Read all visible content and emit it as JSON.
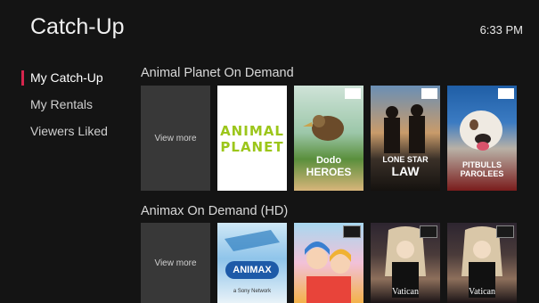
{
  "header": {
    "title": "Catch-Up",
    "time": "6:33 PM"
  },
  "sidebar": {
    "items": [
      {
        "label": "My Catch-Up",
        "active": true
      },
      {
        "label": "My Rentals",
        "active": false
      },
      {
        "label": "Viewers Liked",
        "active": false
      }
    ]
  },
  "rows": [
    {
      "title": "Animal Planet On Demand",
      "tiles": [
        {
          "kind": "view-more",
          "label": "View more"
        },
        {
          "kind": "poster",
          "name": "Animal Planet",
          "art": "animal-planet-logo"
        },
        {
          "kind": "poster",
          "name": "Dodo Heroes",
          "art": "dodo-heroes"
        },
        {
          "kind": "poster",
          "name": "Lone Star Law",
          "art": "lone-star-law"
        },
        {
          "kind": "poster",
          "name": "Pitbulls & Parolees",
          "art": "pitbulls-parolees"
        }
      ]
    },
    {
      "title": "Animax On Demand (HD)",
      "tiles": [
        {
          "kind": "view-more",
          "label": "View more"
        },
        {
          "kind": "poster",
          "name": "Animax",
          "art": "animax-logo"
        },
        {
          "kind": "poster",
          "name": "anime-poster",
          "art": "anime-poster"
        },
        {
          "kind": "poster",
          "name": "Vatican",
          "art": "vatican"
        },
        {
          "kind": "poster",
          "name": "Vatican",
          "art": "vatican"
        }
      ]
    }
  ],
  "poster_text": {
    "animal_planet_top": "ANIMAL",
    "animal_planet_bottom": "PLANET",
    "dodo_line1": "Dodo",
    "dodo_line2": "HEROES",
    "lonestar_line1": "LONE STAR",
    "lonestar_line2": "LAW",
    "pitbull_line1": "PITBULLS",
    "pitbull_line2": "PAROLEES",
    "animax_logo": "ANIMAX",
    "animax_sub": "a Sony Network",
    "vatican": "Vatican"
  },
  "colors": {
    "background": "#141414",
    "accent": "#d6254d",
    "tile": "#383838",
    "animal_planet_green": "#9cc61b"
  }
}
